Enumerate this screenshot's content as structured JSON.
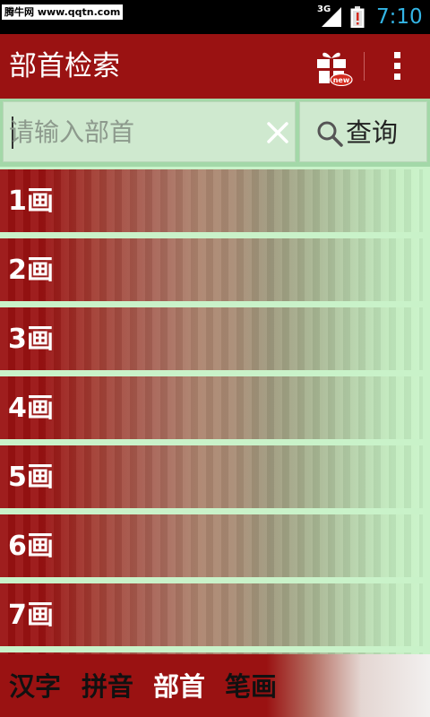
{
  "status_bar": {
    "watermark": "腾牛网 www.qqtn.com",
    "network_label": "3G",
    "time": "7:10",
    "clock_color": "#33b5e5",
    "icons": [
      "signal-icon",
      "battery-alert-icon"
    ]
  },
  "action_bar": {
    "title": "部首检索",
    "gift_badge": "new",
    "background_color": "#9a1212",
    "icons": [
      "gift-new-icon",
      "overflow-menu-icon"
    ]
  },
  "search": {
    "placeholder": "请输入部首",
    "value": "",
    "button_label": "查询",
    "icons": [
      "clear-icon",
      "search-icon"
    ]
  },
  "radical_groups": [
    {
      "label": "1画"
    },
    {
      "label": "2画"
    },
    {
      "label": "3画"
    },
    {
      "label": "4画"
    },
    {
      "label": "5画"
    },
    {
      "label": "6画"
    },
    {
      "label": "7画"
    }
  ],
  "bottom_tabs": [
    {
      "label": "汉字",
      "active": false
    },
    {
      "label": "拼音",
      "active": false
    },
    {
      "label": "部首",
      "active": true
    },
    {
      "label": "笔画",
      "active": false
    }
  ]
}
